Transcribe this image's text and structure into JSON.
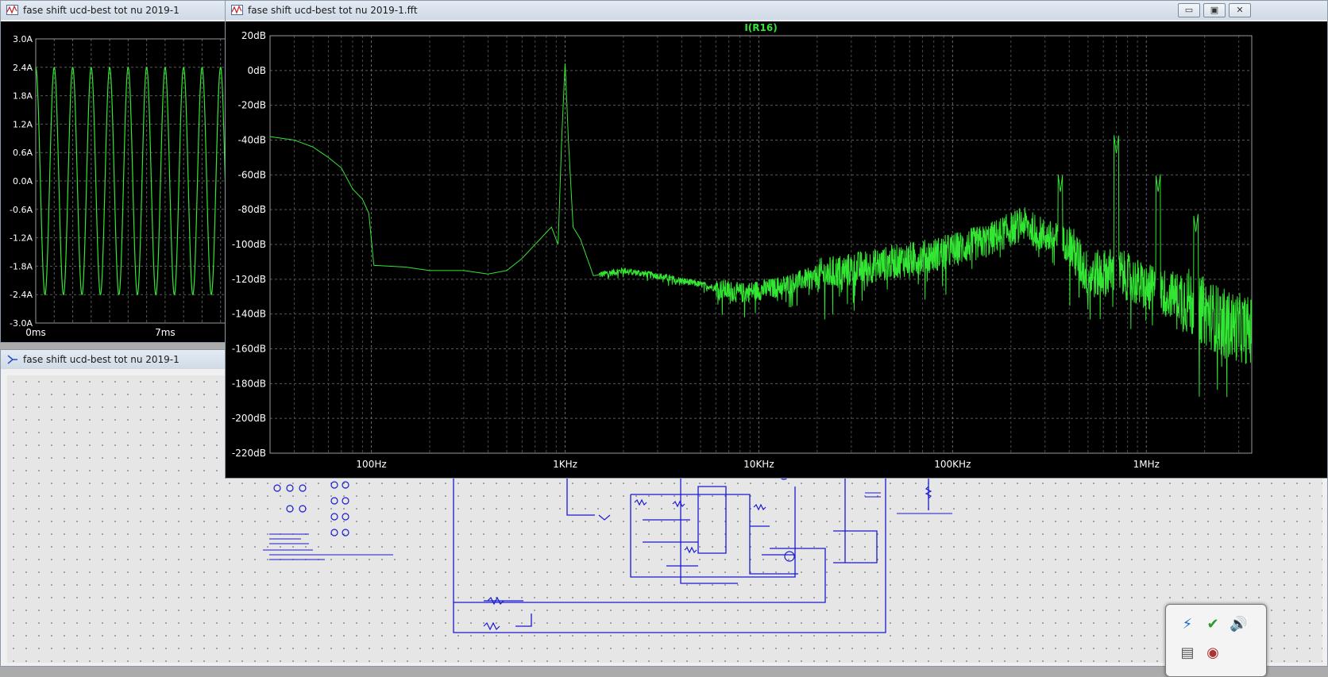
{
  "time_window": {
    "title": "fase shift ucd-best tot nu 2019-1",
    "yticks": [
      "3.0A",
      "2.4A",
      "1.8A",
      "1.2A",
      "0.6A",
      "0.0A",
      "-0.6A",
      "-1.2A",
      "-1.8A",
      "-2.4A",
      "-3.0A"
    ],
    "xticks": [
      "0ms",
      "7ms"
    ]
  },
  "schematic_window": {
    "title": "fase shift ucd-best tot nu 2019-1"
  },
  "fft_window": {
    "title": "fase shift ucd-best tot nu 2019-1.fft",
    "buttons": {
      "minimize": "▭",
      "maximize": "▣",
      "close": "✕"
    }
  },
  "chart_data": [
    {
      "type": "line",
      "title": "",
      "ylim": [
        -3.0,
        3.0
      ],
      "xlim": [
        0,
        10.4
      ],
      "x_unit": "ms",
      "y_unit": "A",
      "grid": true,
      "series": [
        {
          "amplitude": 2.4,
          "frequency_khz": 1.0,
          "color": "#33e633"
        }
      ]
    },
    {
      "type": "line",
      "title": "I(R16)",
      "ylim": [
        -220,
        20
      ],
      "xlim": [
        30,
        3500000
      ],
      "x_scale": "log",
      "y_unit": "dB",
      "grid": true,
      "yticks": [
        "20dB",
        "0dB",
        "-20dB",
        "-40dB",
        "-60dB",
        "-80dB",
        "-100dB",
        "-120dB",
        "-140dB",
        "-160dB",
        "-180dB",
        "-200dB",
        "-220dB"
      ],
      "xticks": [
        {
          "value": 100,
          "label": "100Hz"
        },
        {
          "value": 1000,
          "label": "1KHz"
        },
        {
          "value": 10000,
          "label": "10KHz"
        },
        {
          "value": 100000,
          "label": "100KHz"
        },
        {
          "value": 1000000,
          "label": "1MHz"
        }
      ],
      "series": [
        {
          "name": "I(R16)",
          "color": "#33e633",
          "envelope": [
            {
              "f": 30,
              "db": -38
            },
            {
              "f": 40,
              "db": -40
            },
            {
              "f": 50,
              "db": -44
            },
            {
              "f": 60,
              "db": -50
            },
            {
              "f": 70,
              "db": -56
            },
            {
              "f": 80,
              "db": -68
            },
            {
              "f": 90,
              "db": -74
            },
            {
              "f": 97,
              "db": -82
            },
            {
              "f": 103,
              "db": -112
            },
            {
              "f": 150,
              "db": -113
            },
            {
              "f": 200,
              "db": -115
            },
            {
              "f": 300,
              "db": -115
            },
            {
              "f": 400,
              "db": -117
            },
            {
              "f": 500,
              "db": -115
            },
            {
              "f": 600,
              "db": -108
            },
            {
              "f": 700,
              "db": -100
            },
            {
              "f": 850,
              "db": -90
            },
            {
              "f": 920,
              "db": -100
            },
            {
              "f": 960,
              "db": -40
            },
            {
              "f": 1000,
              "db": 5
            },
            {
              "f": 1040,
              "db": -40
            },
            {
              "f": 1100,
              "db": -90
            },
            {
              "f": 1200,
              "db": -97
            },
            {
              "f": 1400,
              "db": -118
            },
            {
              "f": 2000,
              "db": -115
            },
            {
              "f": 3000,
              "db": -118
            },
            {
              "f": 5000,
              "db": -123
            },
            {
              "f": 8000,
              "db": -128
            },
            {
              "f": 12000,
              "db": -125
            },
            {
              "f": 20000,
              "db": -118
            },
            {
              "f": 40000,
              "db": -112
            },
            {
              "f": 80000,
              "db": -106
            },
            {
              "f": 150000,
              "db": -98
            },
            {
              "f": 230000,
              "db": -88
            },
            {
              "f": 300000,
              "db": -95
            },
            {
              "f": 400000,
              "db": -100
            },
            {
              "f": 500000,
              "db": -118
            },
            {
              "f": 700000,
              "db": -115
            },
            {
              "f": 1000000,
              "db": -125
            },
            {
              "f": 1500000,
              "db": -130
            },
            {
              "f": 2500000,
              "db": -145
            },
            {
              "f": 3500000,
              "db": -150
            }
          ],
          "spikes": [
            {
              "f": 360000,
              "db": -70
            },
            {
              "f": 700000,
              "db": -48
            },
            {
              "f": 1150000,
              "db": -70
            },
            {
              "f": 1800000,
              "db": -93
            }
          ]
        }
      ]
    }
  ]
}
